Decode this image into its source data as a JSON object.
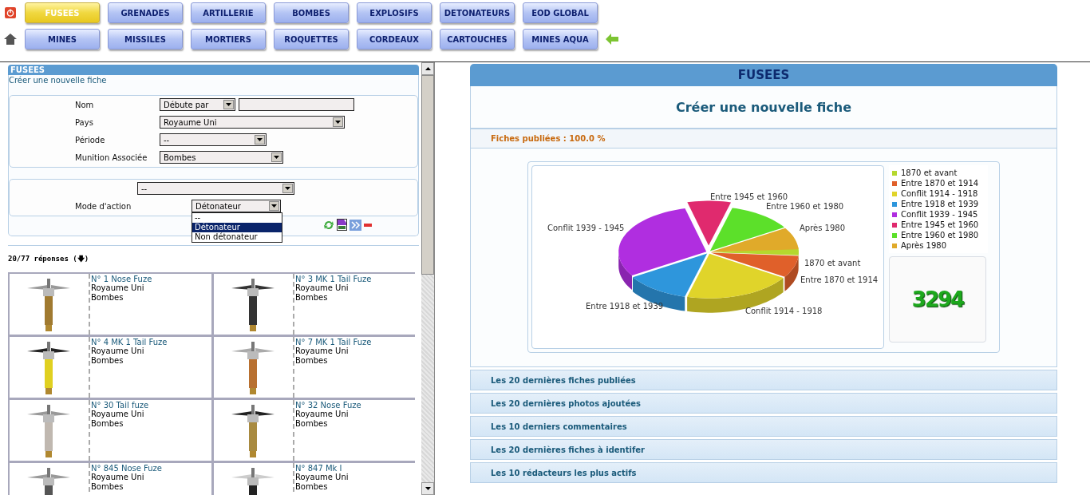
{
  "nav": {
    "rows": [
      [
        {
          "label": "FUSEES",
          "selected": true
        },
        {
          "label": "GRENADES",
          "selected": false
        },
        {
          "label": "ARTILLERIE",
          "selected": false
        },
        {
          "label": "BOMBES",
          "selected": false
        },
        {
          "label": "EXPLOSIFS",
          "selected": false
        },
        {
          "label": "DETONATEURS",
          "selected": false
        },
        {
          "label": "EOD GLOBAL",
          "selected": false
        }
      ],
      [
        {
          "label": "MINES",
          "selected": false
        },
        {
          "label": "MISSILES",
          "selected": false
        },
        {
          "label": "MORTIERS",
          "selected": false
        },
        {
          "label": "ROQUETTES",
          "selected": false
        },
        {
          "label": "CORDEAUX",
          "selected": false
        },
        {
          "label": "CARTOUCHES",
          "selected": false
        },
        {
          "label": "MINES AQUA",
          "selected": false
        }
      ]
    ]
  },
  "search": {
    "title": "FUSEES",
    "create_link": "Créer une nouvelle fiche",
    "fields": [
      {
        "label": "Nom",
        "mode": "Débute par"
      },
      {
        "label": "Pays",
        "value": "Royaume Uni"
      },
      {
        "label": "Période",
        "value": "--"
      },
      {
        "label": "Munition Associée",
        "value": "Bombes"
      }
    ],
    "extra_select": "--",
    "action": {
      "label": "Mode d'action",
      "value": "Détonateur",
      "options": [
        {
          "label": "--",
          "selected": false
        },
        {
          "label": "Détonateur",
          "selected": true
        },
        {
          "label": "Non détonateur",
          "selected": false
        }
      ]
    },
    "count": "20/77 réponses (🡇)"
  },
  "results": [
    {
      "name": "N° 1 Nose Fuze",
      "country": "Royaume Uni",
      "type": "Bombes"
    },
    {
      "name": "N° 3 MK 1 Tail Fuze",
      "country": "Royaume Uni",
      "type": "Bombes"
    },
    {
      "name": "N° 4 MK 1 Tail Fuze",
      "country": "Royaume Uni",
      "type": "Bombes"
    },
    {
      "name": "N° 7 MK 1 Tail Fuze",
      "country": "Royaume Uni",
      "type": "Bombes"
    },
    {
      "name": "N° 30 Tail fuze",
      "country": "Royaume Uni",
      "type": "Bombes"
    },
    {
      "name": "N° 32 Nose Fuze",
      "country": "Royaume Uni",
      "type": "Bombes"
    },
    {
      "name": "N° 845 Nose Fuze",
      "country": "Royaume Uni",
      "type": "Bombes"
    },
    {
      "name": "N° 847 Mk I",
      "country": "Royaume Uni",
      "type": "Bombes"
    }
  ],
  "main": {
    "title": "FUSEES",
    "create": "Créer une nouvelle fiche",
    "published": "Fiches publiées : 100.0 %",
    "slices": [
      {
        "label": "1870 et avant",
        "color": "#b5d82e"
      },
      {
        "label": "Entre 1870 et 1914",
        "color": "#e0602a"
      },
      {
        "label": "Conflit 1914 - 1918",
        "color": "#e0d42a"
      },
      {
        "label": "Entre 1918 et 1939",
        "color": "#2e96dc"
      },
      {
        "label": "Conflit 1939 - 1945",
        "color": "#b02ee0"
      },
      {
        "label": "Entre 1945 et 1960",
        "color": "#e02a6e"
      },
      {
        "label": "Entre 1960 et 1980",
        "color": "#5ce02a"
      },
      {
        "label": "Après 1980",
        "color": "#e0aa2a"
      }
    ],
    "legend": [
      "1870 et avant",
      "Entre 1870 et 1914",
      "Conflit 1914 - 1918",
      "Entre 1918 et 1939",
      "Conflit 1939 - 1945",
      "Entre 1945 et 1960",
      "Entre 1960 et 1980",
      "Après 1980"
    ],
    "total": "3294",
    "sections": [
      "Les 20 dernières fiches publiées",
      "Les 20 dernières photos ajoutées",
      "Les 10 derniers commentaires",
      "Les 20 dernières fiches à identifer",
      "Les 10 rédacteurs les plus actifs"
    ]
  }
}
